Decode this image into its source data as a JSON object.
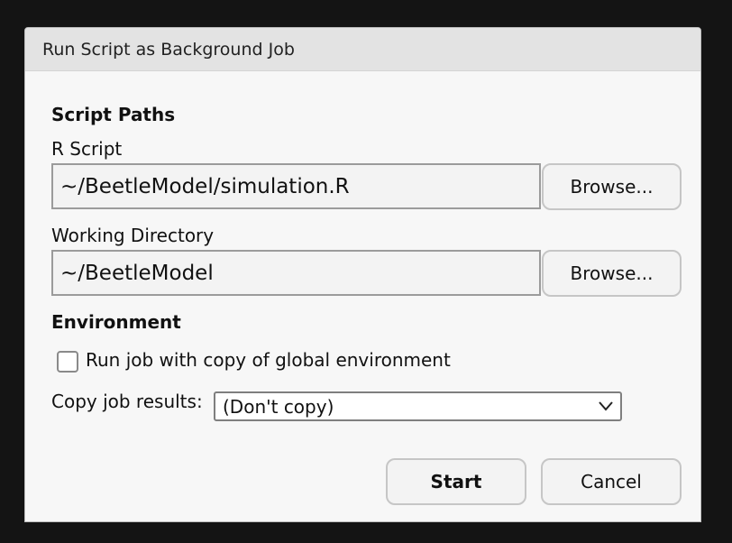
{
  "dialog": {
    "title": "Run Script as Background Job"
  },
  "script_paths": {
    "heading": "Script Paths",
    "r_script_label": "R Script",
    "r_script_value": "~/BeetleModel/simulation.R",
    "working_dir_label": "Working Directory",
    "working_dir_value": "~/BeetleModel",
    "browse_label": "Browse..."
  },
  "environment": {
    "heading": "Environment",
    "checkbox_label": "Run job with copy of global environment",
    "checkbox_checked": false,
    "copy_results_label": "Copy job results:",
    "copy_results_value": "(Don't copy)"
  },
  "footer": {
    "start_label": "Start",
    "cancel_label": "Cancel"
  }
}
